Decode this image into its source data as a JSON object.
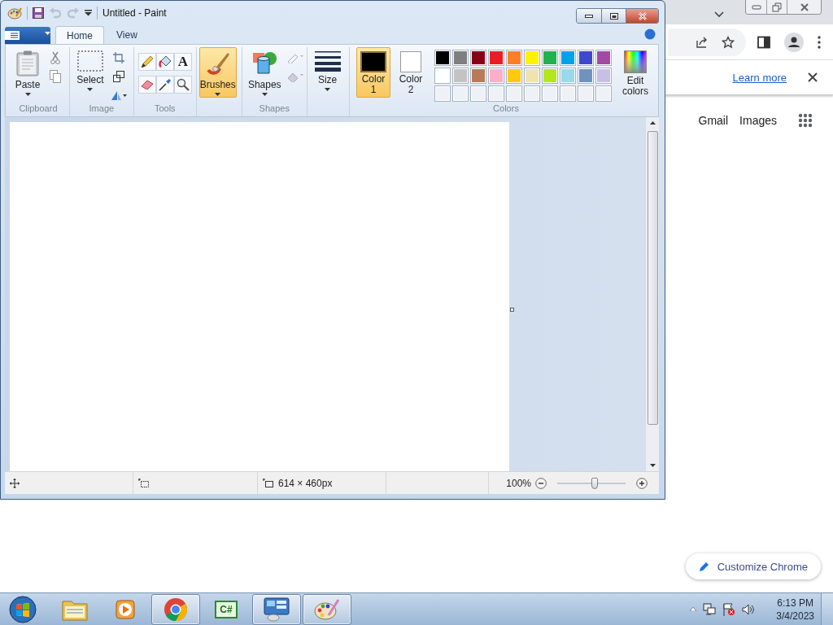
{
  "paint": {
    "title": "Untitled - Paint",
    "tabs": [
      {
        "label": "Home",
        "selected": true
      },
      {
        "label": "View",
        "selected": false
      }
    ],
    "groups": [
      {
        "kind": "clipboard",
        "label": "Clipboard",
        "buttons": [
          {
            "label": "Paste",
            "selected": false
          }
        ]
      },
      {
        "kind": "image",
        "label": "Image",
        "buttons": [
          {
            "label": "Select",
            "selected": false
          }
        ]
      },
      {
        "kind": "tools",
        "label": "Tools",
        "glyph": "A"
      },
      {
        "kind": "brushes",
        "buttons": [
          {
            "label": "Brushes",
            "selected": true
          }
        ]
      },
      {
        "kind": "shapes",
        "label": "Shapes",
        "buttons": [
          {
            "label": "Shapes",
            "selected": false
          }
        ]
      },
      {
        "kind": "size",
        "buttons": [
          {
            "label": "Size",
            "selected": false
          }
        ]
      },
      {
        "kind": "colors",
        "label": "Colors",
        "swatches": [
          {
            "label": "Color 1",
            "color": "#000000",
            "selected": true
          },
          {
            "label": "Color 2",
            "color": "#ffffff",
            "selected": false
          }
        ],
        "palette": [
          {
            "color": "#000000"
          },
          {
            "color": "#7f7f7f"
          },
          {
            "color": "#880015"
          },
          {
            "color": "#ed1c24"
          },
          {
            "color": "#ff7f27"
          },
          {
            "color": "#fff200"
          },
          {
            "color": "#22b14c"
          },
          {
            "color": "#00a2e8"
          },
          {
            "color": "#3f48cc"
          },
          {
            "color": "#a349a4"
          },
          {
            "color": "#ffffff"
          },
          {
            "color": "#c3c3c3"
          },
          {
            "color": "#b97a57"
          },
          {
            "color": "#ffaec9"
          },
          {
            "color": "#ffc90e"
          },
          {
            "color": "#efe4b0"
          },
          {
            "color": "#b5e61d"
          },
          {
            "color": "#99d9ea"
          },
          {
            "color": "#7092be"
          },
          {
            "color": "#c8bfe7"
          }
        ],
        "edit_label": "Edit colors"
      }
    ],
    "status_bar": {
      "canvas_size": "614 × 460px",
      "zoom": "100%",
      "zoom_slider": {
        "level": 0.55
      }
    }
  },
  "chrome": {
    "infobar_link": "Learn more",
    "links": [
      "Gmail",
      "Images"
    ],
    "customize": "Customize Chrome"
  },
  "taskbar": {
    "items": [
      {
        "running": false
      },
      {
        "running": false
      },
      {
        "running": true
      },
      {
        "running": false,
        "label": "C#"
      },
      {
        "running": true
      },
      {
        "running": true
      }
    ],
    "time": "6:13 PM",
    "date": "3/4/2023"
  }
}
